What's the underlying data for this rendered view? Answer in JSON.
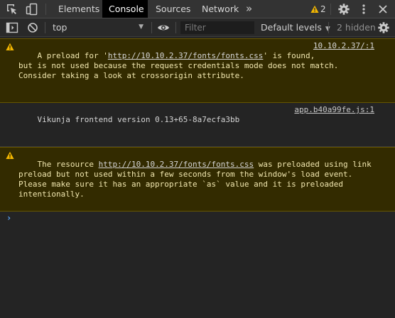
{
  "tabs": {
    "items": [
      {
        "label": "Elements"
      },
      {
        "label": "Console"
      },
      {
        "label": "Sources"
      },
      {
        "label": "Network"
      }
    ],
    "more_symbol": "»",
    "warning_count": "2"
  },
  "toolbar": {
    "context": "top",
    "filter_placeholder": "Filter",
    "levels": "Default levels",
    "hidden": "2 hidden"
  },
  "messages": [
    {
      "level": "warning",
      "text_before": "A preload for '",
      "link": "http://10.10.2.37/fonts/fonts.css",
      "text_after": "' is found,\nbut is not used because the request credentials mode does not match.\nConsider taking a look at crossorigin attribute.",
      "source": "10.10.2.37/:1"
    },
    {
      "level": "log",
      "text": "Vikunja frontend version 0.13+65-8a7ecfa3bb",
      "source": "app.b40a99fe.js:1"
    },
    {
      "level": "warning",
      "text_before": "The resource ",
      "link": "http://10.10.2.37/fonts/fonts.css",
      "text_after": " was preloaded using link\npreload but not used within a few seconds from the window's load event.\nPlease make sure it has an appropriate `as` value and it is preloaded\nintentionally."
    }
  ],
  "prompt_symbol": "›",
  "colors": {
    "warning_bg": "#332b00",
    "warning_text": "#f0e6ae",
    "warning_icon": "#f2b600",
    "active_tab_bg": "#000000",
    "prompt": "#5aa9ff"
  },
  "icons": {
    "inspect": "inspect-element-icon",
    "device": "device-toggle-icon",
    "sidebar": "sidebar-toggle-icon",
    "clear": "clear-console-icon",
    "eye": "live-expression-eye-icon",
    "settings": "gear-icon",
    "close": "close-icon",
    "menu": "kebab-menu-icon",
    "warning": "warning-icon"
  }
}
